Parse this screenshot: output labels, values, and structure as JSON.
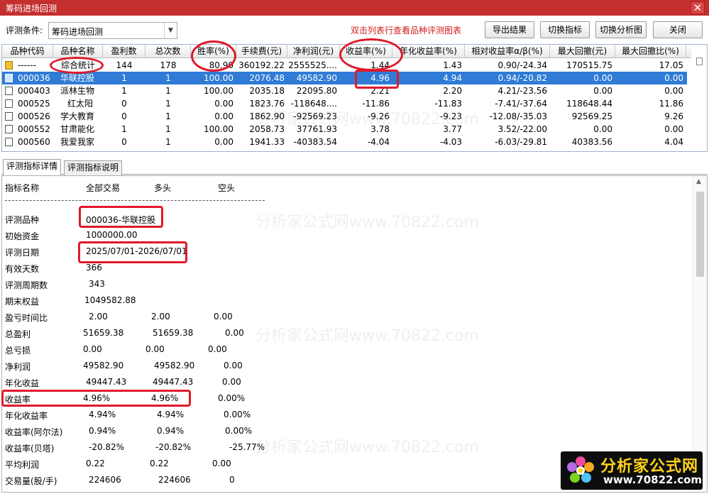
{
  "window": {
    "title": "筹码进场回测",
    "close_glyph": "✕"
  },
  "toolbar": {
    "condition_label": "评测条件:",
    "condition_value": "筹码进场回测",
    "hint": "双击列表行查看品种评测图表",
    "buttons": [
      "导出结果",
      "切换指标",
      "切换分析图",
      "关闭"
    ]
  },
  "grid": {
    "columns": [
      "品种代码",
      "品种名称",
      "盈利数",
      "总次数",
      "胜率(%)",
      "手续费(元)",
      "净利润(元)",
      "收益率(%)",
      "年化收益率(%)",
      "相对收益率α/β(%)",
      "最大回撤(元)",
      "最大回撤比(%)"
    ],
    "rows": [
      {
        "code": "------",
        "name": "综合统计",
        "win": "144",
        "total": "178",
        "rate": "80.90",
        "fee": "360192.22",
        "profit": "2555525....",
        "ret": "1.44",
        "annual": "1.43",
        "rel": "0.90/-24.34",
        "dd": "170515.75",
        "ddr": "17.05",
        "kind": "sum"
      },
      {
        "code": "000036",
        "name": "华联控股",
        "win": "1",
        "total": "1",
        "rate": "100.00",
        "fee": "2076.48",
        "profit": "49582.90",
        "ret": "4.96",
        "annual": "4.94",
        "rel": "0.94/-20.82",
        "dd": "0.00",
        "ddr": "0.00",
        "kind": "selected"
      },
      {
        "code": "000403",
        "name": "派林生物",
        "win": "1",
        "total": "1",
        "rate": "100.00",
        "fee": "2035.18",
        "profit": "22095.80",
        "ret": "2.21",
        "annual": "2.20",
        "rel": "4.21/-23.56",
        "dd": "0.00",
        "ddr": "0.00",
        "kind": ""
      },
      {
        "code": "000525",
        "name": "红太阳",
        "win": "0",
        "total": "1",
        "rate": "0.00",
        "fee": "1823.76",
        "profit": "-118648....",
        "ret": "-11.86",
        "annual": "-11.83",
        "rel": "-7.41/-37.64",
        "dd": "118648.44",
        "ddr": "11.86",
        "kind": ""
      },
      {
        "code": "000526",
        "name": "学大教育",
        "win": "0",
        "total": "1",
        "rate": "0.00",
        "fee": "1862.90",
        "profit": "-92569.23",
        "ret": "-9.26",
        "annual": "-9.23",
        "rel": "-12.08/-35.03",
        "dd": "92569.25",
        "ddr": "9.26",
        "kind": ""
      },
      {
        "code": "000552",
        "name": "甘肃能化",
        "win": "1",
        "total": "1",
        "rate": "100.00",
        "fee": "2058.73",
        "profit": "37761.93",
        "ret": "3.78",
        "annual": "3.77",
        "rel": "3.52/-22.00",
        "dd": "0.00",
        "ddr": "0.00",
        "kind": ""
      },
      {
        "code": "000560",
        "name": "我爱我家",
        "win": "0",
        "total": "1",
        "rate": "0.00",
        "fee": "1941.33",
        "profit": "-40383.54",
        "ret": "-4.04",
        "annual": "-4.03",
        "rel": "-6.03/-29.81",
        "dd": "40383.56",
        "ddr": "4.04",
        "kind": ""
      }
    ]
  },
  "tabs": [
    "评测指标详情",
    "评测指标说明"
  ],
  "detail": {
    "headers": [
      "指标名称",
      "全部交易",
      "多头",
      "空头"
    ],
    "rows": [
      {
        "label": "评测品种",
        "v1": "000036-华联控股",
        "v2": "",
        "v3": ""
      },
      {
        "label": "初始资金",
        "v1": "1000000.00",
        "v2": "",
        "v3": ""
      },
      {
        "label": "评测日期",
        "v1": "2025/07/01-2026/07/01",
        "v2": "",
        "v3": ""
      },
      {
        "label": "有效天数",
        "v1": "366",
        "v2": "",
        "v3": ""
      },
      {
        "label": "评测周期数",
        "v1": "343",
        "v2": "",
        "v3": ""
      },
      {
        "label": "期末权益",
        "v1": "1049582.88",
        "v2": "",
        "v3": ""
      },
      {
        "label": "盈亏时间比",
        "v1": "2.00",
        "v2": "2.00",
        "v3": "0.00"
      },
      {
        "label": "总盈利",
        "v1": "51659.38",
        "v2": "51659.38",
        "v3": "0.00"
      },
      {
        "label": "总亏损",
        "v1": "0.00",
        "v2": "0.00",
        "v3": "0.00"
      },
      {
        "label": "净利润",
        "v1": "49582.90",
        "v2": "49582.90",
        "v3": "0.00"
      },
      {
        "label": "年化收益",
        "v1": "49447.43",
        "v2": "49447.43",
        "v3": "0.00"
      },
      {
        "label": "收益率",
        "v1": "4.96%",
        "v2": "4.96%",
        "v3": "0.00%"
      },
      {
        "label": "年化收益率",
        "v1": "4.94%",
        "v2": "4.94%",
        "v3": "0.00%"
      },
      {
        "label": "收益率(阿尔法)",
        "v1": "0.94%",
        "v2": "0.94%",
        "v3": "0.00%"
      },
      {
        "label": "收益率(贝塔)",
        "v1": "-20.82%",
        "v2": "-20.82%",
        "v3": "-25.77%"
      },
      {
        "label": "平均利润",
        "v1": "0.22",
        "v2": "0.22",
        "v3": "0.00"
      },
      {
        "label": "交易量(股/手)",
        "v1": "224606",
        "v2": "224606",
        "v3": "0"
      }
    ]
  },
  "watermark": {
    "text": "分析家公式网www.70822.com"
  },
  "logo": {
    "name": "分析家公式网",
    "url": "www.70822.com"
  },
  "colors": {
    "title_bar": "#c42f2f",
    "selection": "#2f7bd6",
    "highlight": "#e0192b",
    "hint": "#d41c1c",
    "logo_name": "#ffd21a"
  }
}
